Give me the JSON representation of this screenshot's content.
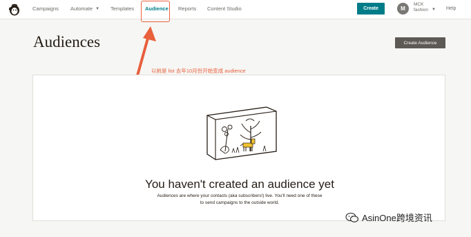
{
  "nav": {
    "items": [
      {
        "label": "Campaigns"
      },
      {
        "label": "Automate",
        "chevron": "chevron-down-icon"
      },
      {
        "label": "Templates"
      },
      {
        "label": "Audience",
        "active": true
      },
      {
        "label": "Reports"
      },
      {
        "label": "Content Studio"
      }
    ],
    "create_label": "Create",
    "avatar_initial": "M",
    "account_line1": "MCK",
    "account_line2": "fashion",
    "help_label": "Help"
  },
  "header": {
    "title": "Audiences",
    "create_audience_label": "Create Audience"
  },
  "annotation": {
    "text": "以前是 list 去年10月份开始变成 audience",
    "color": "#e8603c"
  },
  "empty_state": {
    "title": "You haven't created an audience yet",
    "description_line1": "Audiences are where your contacts (aka subscribers!) live. You'll need one of these",
    "description_line2": "to send campaigns to the outside world."
  },
  "watermark": {
    "text": "AsinOne跨境资讯"
  },
  "colors": {
    "accent": "#007c89",
    "annotation": "#e8603c",
    "secondary_button": "#5d5a55"
  }
}
